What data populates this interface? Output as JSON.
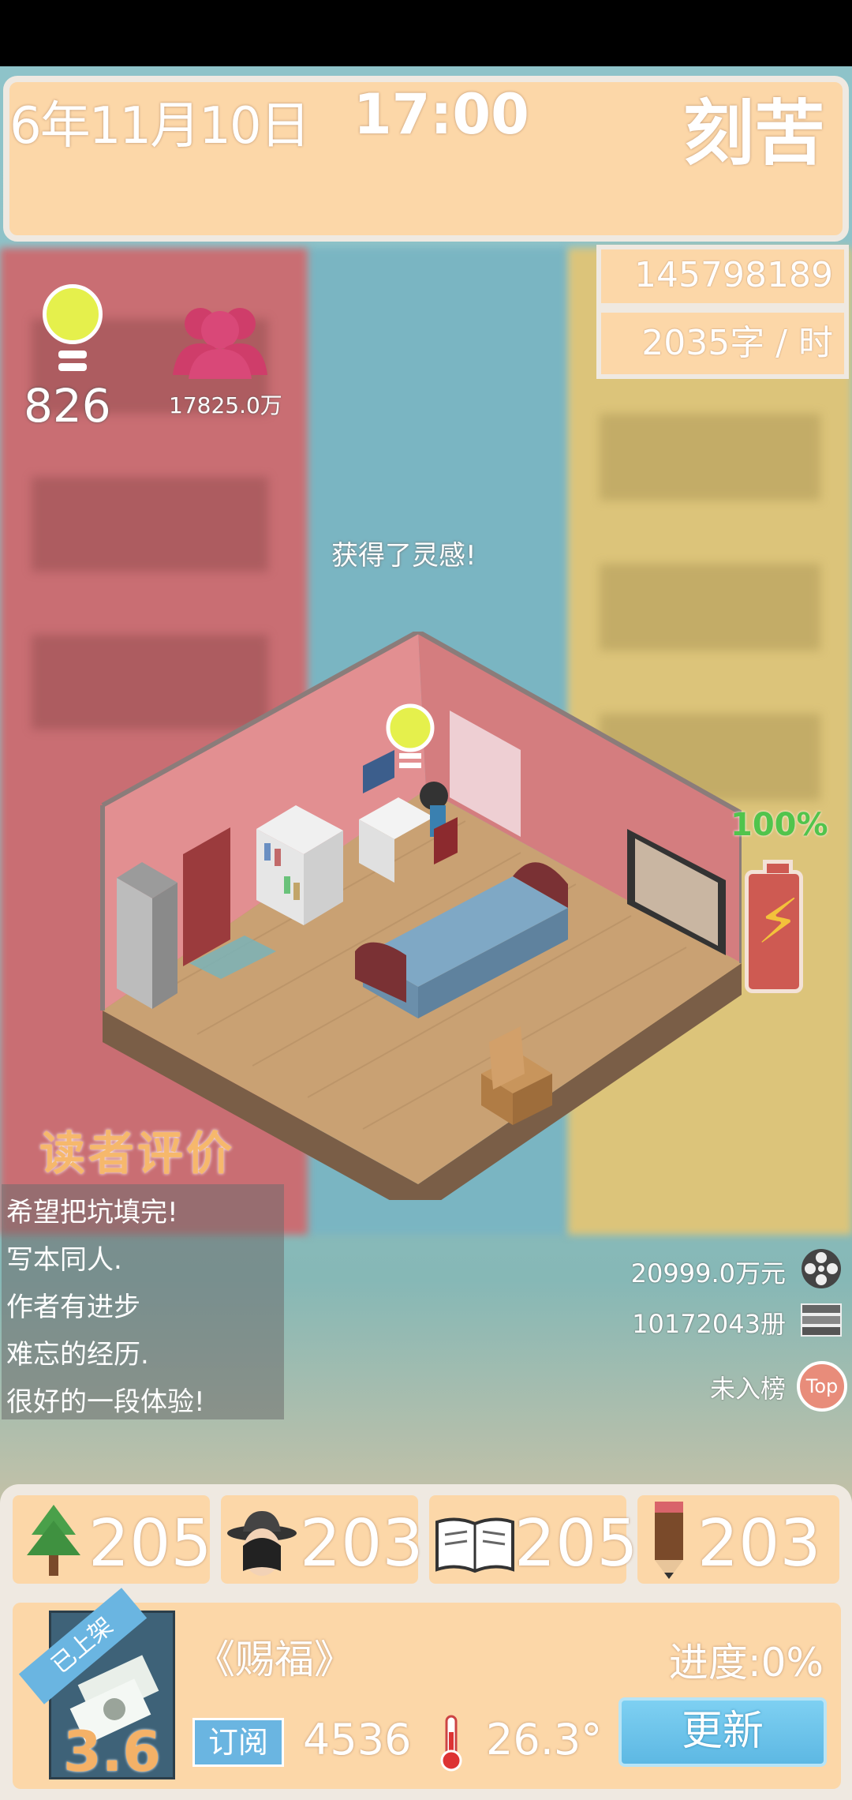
{
  "header": {
    "date": "6年11月10日",
    "time": "17:00",
    "mood": "刻苦"
  },
  "stats": {
    "money": "145798189元",
    "speed": "2035字 / 时"
  },
  "inspiration": {
    "value": "826",
    "icon": "lightbulb-icon"
  },
  "fans": {
    "value": "17825.0万",
    "icon": "people-icon"
  },
  "event_text": "获得了灵感!",
  "battery": {
    "percent_label": "100%",
    "level": 1.0
  },
  "reviews": {
    "title": "读者评价",
    "items": [
      "希望把坑填完!",
      "写本同人.",
      "作者有进步",
      "难忘的经历.",
      "很好的一段体验!"
    ]
  },
  "right_stats": {
    "film_revenue": "20999.0万元",
    "books_sold": "10172043册",
    "ranking": "未入榜",
    "ranking_badge": "Top"
  },
  "attributes": [
    {
      "icon": "tree-icon",
      "value": "205"
    },
    {
      "icon": "detective-hat-icon",
      "value": "203"
    },
    {
      "icon": "open-book-icon",
      "value": "205"
    },
    {
      "icon": "pencil-icon",
      "value": "203"
    }
  ],
  "book": {
    "ribbon": "已上架",
    "rating": "3.6",
    "title": "《赐福》",
    "progress": "进度:0%",
    "subscribe_label": "订阅",
    "subscriptions": "4536",
    "heat": "26.3°",
    "update_label": "更新"
  },
  "colors": {
    "panel": "#fcd7a8",
    "panel_border": "#efe9e1",
    "accent_blue": "#6ab5e1",
    "battery_green": "#51c44c"
  }
}
